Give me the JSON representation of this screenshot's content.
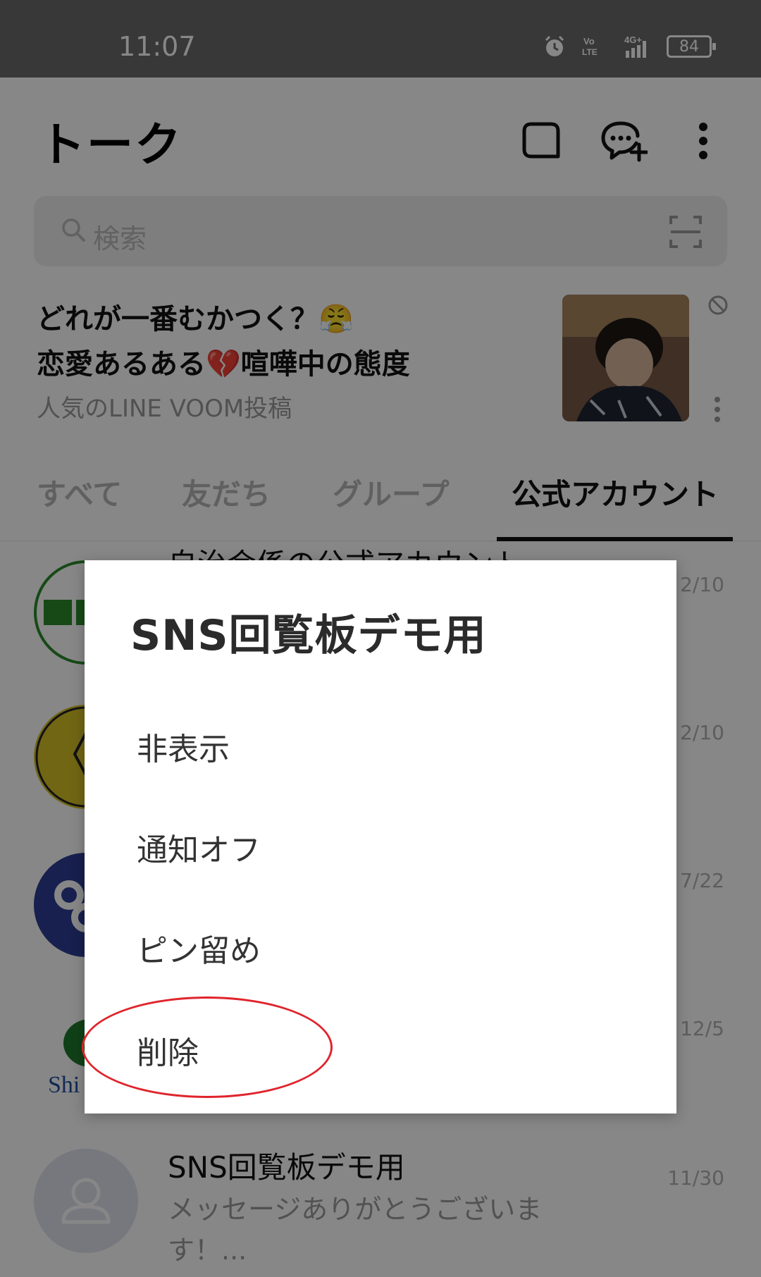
{
  "status_bar": {
    "time": "11:07",
    "battery": "84"
  },
  "header": {
    "title": "トーク"
  },
  "search": {
    "placeholder": "検索"
  },
  "banner": {
    "line1": "どれが一番むかつく？😤",
    "line2": "恋愛あるある💔喧嘩中の態度",
    "sub": "人気のLINE VOOM投稿"
  },
  "tabs": [
    {
      "label": "すべて"
    },
    {
      "label": "友だち"
    },
    {
      "label": "グループ"
    },
    {
      "label": "公式アカウント"
    }
  ],
  "chats": [
    {
      "name": "自治会係の公式アカウント",
      "date": "2/10"
    },
    {
      "name": "",
      "date": "2/10"
    },
    {
      "name": "",
      "date": "7/22"
    },
    {
      "name": "",
      "date": "12/5"
    },
    {
      "name": "SNS回覧板デモ用",
      "message": "メッセージありがとうございま\nす！...",
      "date": "11/30"
    }
  ],
  "dialog": {
    "title": "SNS回覧板デモ用",
    "items": [
      {
        "label": "非表示"
      },
      {
        "label": "通知オフ"
      },
      {
        "label": "ピン留め"
      },
      {
        "label": "削除"
      }
    ]
  },
  "colors": {
    "accent_annotation": "#e0242c",
    "active_tab": "#111111"
  }
}
